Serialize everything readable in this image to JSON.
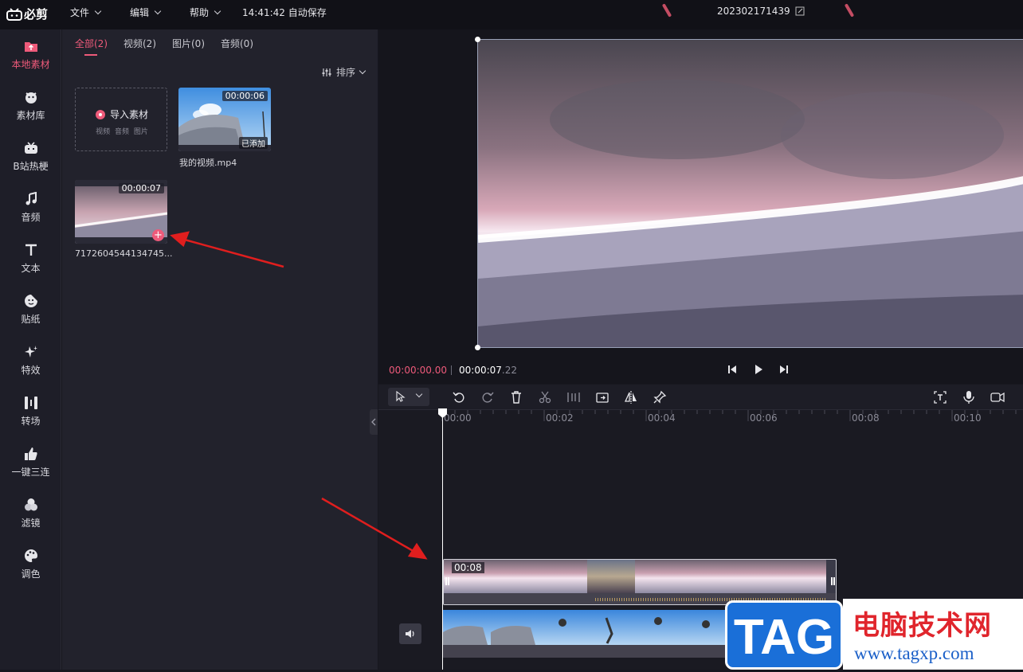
{
  "app": {
    "logo_text": "必剪"
  },
  "menu": {
    "file": "文件",
    "edit": "编辑",
    "help": "帮助"
  },
  "autosave": "14:41:42 自动保存",
  "project_name": "202302171439",
  "sidebar": {
    "items": [
      {
        "label": "本地素材",
        "icon": "upload-folder-icon",
        "active": true
      },
      {
        "label": "素材库",
        "icon": "face-icon"
      },
      {
        "label": "B站热梗",
        "icon": "tv-icon"
      },
      {
        "label": "音频",
        "icon": "music-note-icon"
      },
      {
        "label": "文本",
        "icon": "text-t-icon"
      },
      {
        "label": "贴纸",
        "icon": "sticker-icon"
      },
      {
        "label": "特效",
        "icon": "sparkle-icon"
      },
      {
        "label": "转场",
        "icon": "transition-icon"
      },
      {
        "label": "一键三连",
        "icon": "thumbs-up-icon"
      },
      {
        "label": "滤镜",
        "icon": "filter-circles-icon"
      },
      {
        "label": "调色",
        "icon": "palette-icon"
      }
    ]
  },
  "media": {
    "tabs": [
      {
        "label": "全部(2)",
        "active": true
      },
      {
        "label": "视频(2)"
      },
      {
        "label": "图片(0)"
      },
      {
        "label": "音频(0)"
      }
    ],
    "sort_label": "排序",
    "import": {
      "title": "导入素材",
      "subtitle": "视频 音频 图片"
    },
    "files": [
      {
        "name": "我的视频.mp4",
        "duration": "00:00:06",
        "status": "已添加"
      },
      {
        "name": "7172604544134745...",
        "duration": "00:00:07"
      }
    ]
  },
  "preview": {
    "current_time": "00:00:00.00",
    "total_time_main": "00:00:07",
    "total_time_frac": ".22"
  },
  "timeline": {
    "ruler": [
      "00:00",
      "00:02",
      "00:04",
      "00:06",
      "00:08",
      "00:10"
    ],
    "clip1_duration": "00:08"
  },
  "watermark": {
    "tag": "TAG",
    "cn": "电脑技术网",
    "url": "www.tagxp.com"
  },
  "colors": {
    "accent": "#ee5a7a",
    "bg": "#17171f",
    "annotation_arrow": "#e01e1e"
  }
}
